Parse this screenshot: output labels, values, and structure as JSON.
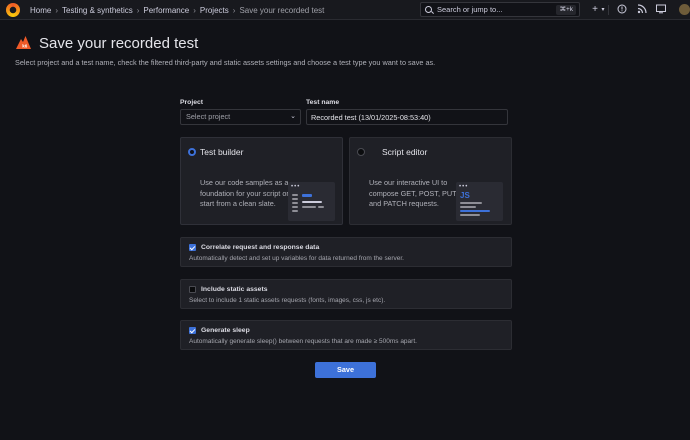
{
  "topbar": {
    "breadcrumbs": [
      "Home",
      "Testing & synthetics",
      "Performance",
      "Projects",
      "Save your recorded test"
    ],
    "search_placeholder": "Search or jump to...",
    "search_shortcut": "⌘+k",
    "icons": [
      "grafana-logo-icon",
      "plus-icon",
      "help-icon",
      "rss-icon",
      "tv-icon",
      "avatar"
    ]
  },
  "header": {
    "title": "Save your recorded test",
    "description": "Select project and a test name, check the filtered third-party and static assets settings and choose a test type you want to save as."
  },
  "form": {
    "project_label": "Project",
    "project_placeholder": "Select project",
    "test_name_label": "Test name",
    "test_name_value": "Recorded test (13/01/2025-08:53:40)"
  },
  "test_types": [
    {
      "title": "Test builder",
      "selected": true,
      "description": "Use our code samples as a foundation for your script or start from a clean slate."
    },
    {
      "title": "Script editor",
      "selected": false,
      "description": "Use our interactive UI to compose GET, POST, PUT and PATCH requests.",
      "badge": "JS"
    }
  ],
  "options": [
    {
      "title": "Correlate request and response data",
      "description": "Automatically detect and set up variables for data returned from the server.",
      "checked": true
    },
    {
      "title": "Include static assets",
      "description": "Select to include 1 static assets requests (fonts, images, css, js etc).",
      "checked": false
    },
    {
      "title": "Generate sleep",
      "description": "Automatically generate sleep() between requests that are made ≥ 500ms apart.",
      "checked": true
    }
  ],
  "save_button": "Save",
  "colors": {
    "accent": "#3d71d9",
    "background": "#111217",
    "panel": "#1f2026",
    "brand": "#f05a28"
  }
}
